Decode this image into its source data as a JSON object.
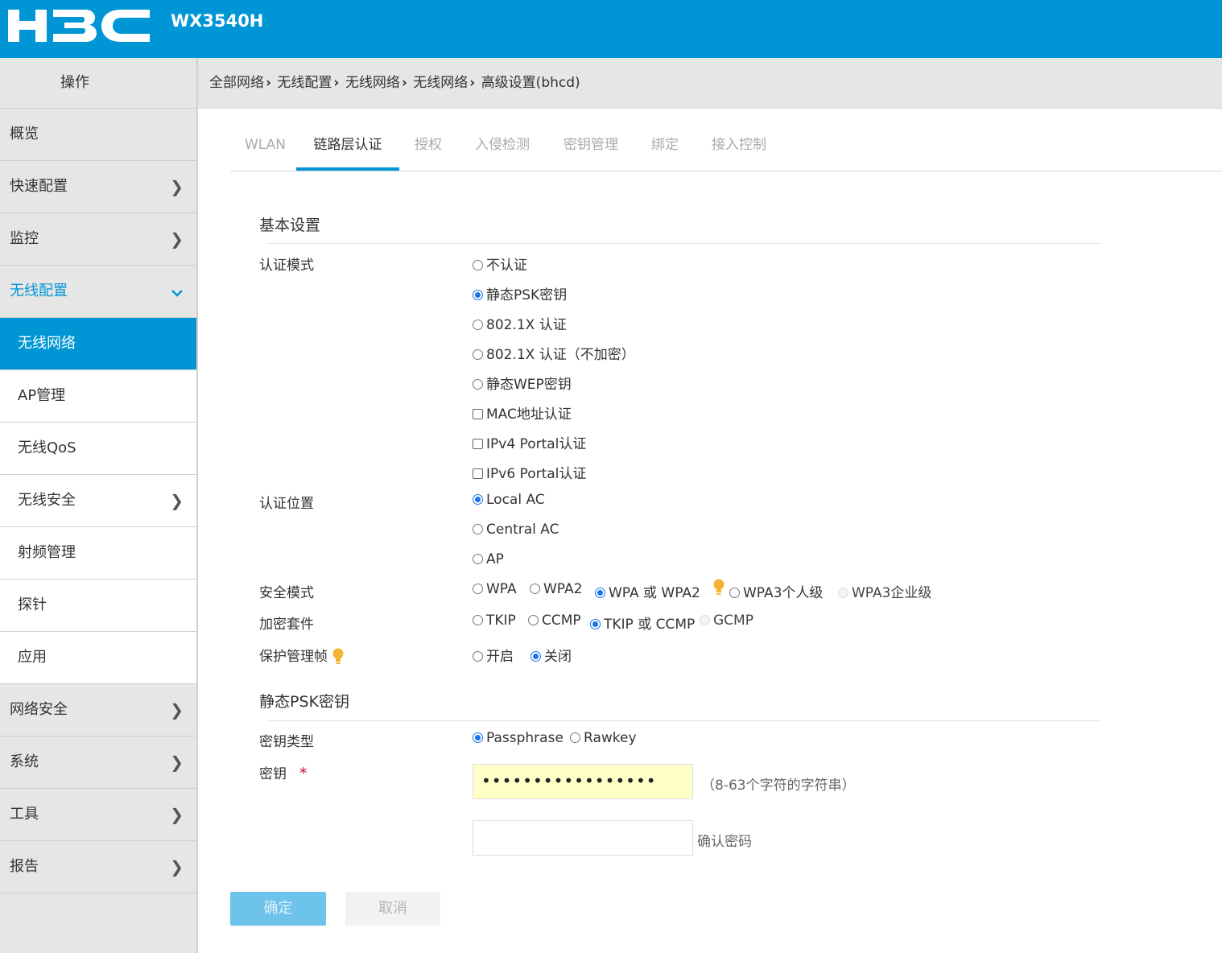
{
  "header": {
    "logo_text": "H3C",
    "model": "WX3540H"
  },
  "sidebar": {
    "header": "操作",
    "items": [
      {
        "label": "概览"
      },
      {
        "label": "快速配置",
        "chevron": "right"
      },
      {
        "label": "监控",
        "chevron": "right"
      },
      {
        "label": "无线配置",
        "chevron": "down",
        "expanded": true
      },
      {
        "label": "无线网络",
        "sub": true,
        "active": true
      },
      {
        "label": "AP管理",
        "sub": true
      },
      {
        "label": "无线QoS",
        "sub": true
      },
      {
        "label": "无线安全",
        "sub": true,
        "chevron": "right"
      },
      {
        "label": "射频管理",
        "sub": true
      },
      {
        "label": "探针",
        "sub": true
      },
      {
        "label": "应用",
        "sub": true
      },
      {
        "label": "网络安全",
        "chevron": "right"
      },
      {
        "label": "系统",
        "chevron": "right"
      },
      {
        "label": "工具",
        "chevron": "right"
      },
      {
        "label": "报告",
        "chevron": "right"
      }
    ]
  },
  "breadcrumb": [
    "全部网络",
    "无线配置",
    "无线网络",
    "无线网络",
    "高级设置(bhcd)"
  ],
  "tabs": [
    {
      "label": "WLAN"
    },
    {
      "label": "链路层认证",
      "active": true
    },
    {
      "label": "授权"
    },
    {
      "label": "入侵检测"
    },
    {
      "label": "密钥管理"
    },
    {
      "label": "绑定"
    },
    {
      "label": "接入控制"
    }
  ],
  "basic": {
    "title": "基本设置",
    "auth_mode": {
      "label": "认证模式",
      "options": [
        "不认证",
        "静态PSK密钥",
        "802.1X 认证",
        "802.1X 认证（不加密）",
        "静态WEP密钥"
      ],
      "selected": "静态PSK密钥",
      "checkboxes": [
        "MAC地址认证",
        "IPv4 Portal认证",
        "IPv6 Portal认证"
      ]
    },
    "auth_location": {
      "label": "认证位置",
      "options": [
        "Local AC",
        "Central AC",
        "AP"
      ],
      "selected": "Local AC"
    },
    "security_mode": {
      "label": "安全模式",
      "options": [
        "WPA",
        "WPA2",
        "WPA 或 WPA2",
        "WPA3个人级",
        "WPA3企业级"
      ],
      "selected": "WPA 或 WPA2",
      "disabled": [
        "WPA3企业级"
      ]
    },
    "cipher_suite": {
      "label": "加密套件",
      "options": [
        "TKIP",
        "CCMP",
        "TKIP 或 CCMP",
        "GCMP"
      ],
      "selected": "TKIP 或 CCMP",
      "disabled": [
        "GCMP"
      ]
    },
    "pmf": {
      "label": "保护管理帧",
      "options": [
        "开启",
        "关闭"
      ],
      "selected": "关闭"
    }
  },
  "psk": {
    "title": "静态PSK密钥",
    "key_type": {
      "label": "密钥类型",
      "options": [
        "Passphrase",
        "Rawkey"
      ],
      "selected": "Passphrase"
    },
    "key": {
      "label": "密钥",
      "required_mark": "*",
      "value": "•••••••••••••••••",
      "hint": "（8-63个字符的字符串）"
    },
    "confirm": {
      "value": "",
      "hint": "确认密码"
    }
  },
  "buttons": {
    "ok": "确定",
    "cancel": "取消"
  },
  "colors": {
    "brand": "#0096d6",
    "radio_selected": "#1a73e8",
    "key_bg": "#ffffc8",
    "bulb": "#f5b335"
  }
}
